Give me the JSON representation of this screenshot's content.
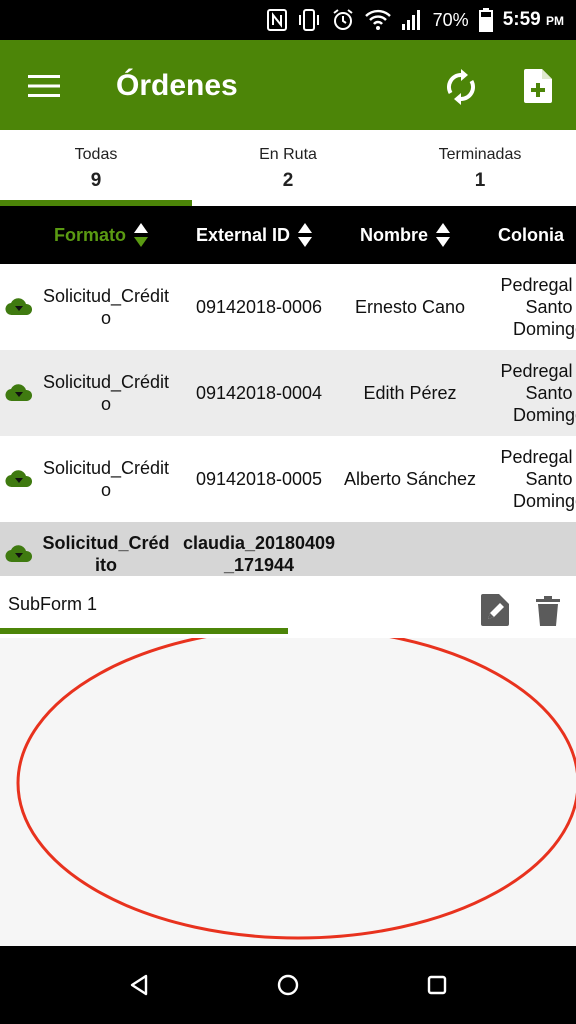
{
  "status_bar": {
    "battery": "70%",
    "time": "5:59",
    "time_suffix": "PM",
    "icons": [
      "nfc-icon",
      "vibrate-icon",
      "alarm-icon",
      "wifi-icon",
      "signal-icon",
      "battery-icon"
    ]
  },
  "app_bar": {
    "title": "Órdenes",
    "icons": [
      "menu-icon",
      "refresh-icon",
      "new-document-icon"
    ],
    "color": "#4c8508"
  },
  "tabs": [
    {
      "label": "Todas",
      "count": "9",
      "active": true
    },
    {
      "label": "En Ruta",
      "count": "2",
      "active": false
    },
    {
      "label": "Terminadas",
      "count": "1",
      "active": false
    }
  ],
  "table": {
    "columns": [
      {
        "label": "Formato",
        "sorted": true
      },
      {
        "label": "External ID",
        "sorted": false
      },
      {
        "label": "Nombre",
        "sorted": false
      },
      {
        "label": "Colonia",
        "sorted": false
      }
    ],
    "rows": [
      {
        "formato": "Solicitud_Crédito",
        "external_id": "09142018-0006",
        "nombre": "Ernesto Cano",
        "colonia": "Pedregal de Santo Domingo"
      },
      {
        "formato": "Solicitud_Crédito",
        "external_id": "09142018-0004",
        "nombre": "Edith Pérez",
        "colonia": "Pedregal de Santo Domingo"
      },
      {
        "formato": "Solicitud_Crédito",
        "external_id": "09142018-0005",
        "nombre": "Alberto Sánchez",
        "colonia": "Pedregal de Santo Domingo"
      },
      {
        "formato": "Solicitud_Crédito",
        "external_id": "claudia_20180409_171944",
        "nombre": "",
        "colonia": ""
      }
    ]
  },
  "subform": {
    "label": "SubForm 1",
    "icons": [
      "edit-icon",
      "delete-icon"
    ]
  },
  "nav_bar": {
    "icons": [
      "back-icon",
      "home-icon",
      "recents-icon"
    ]
  },
  "accent_color": "#4c8508",
  "annotation_color": "#e8321e"
}
